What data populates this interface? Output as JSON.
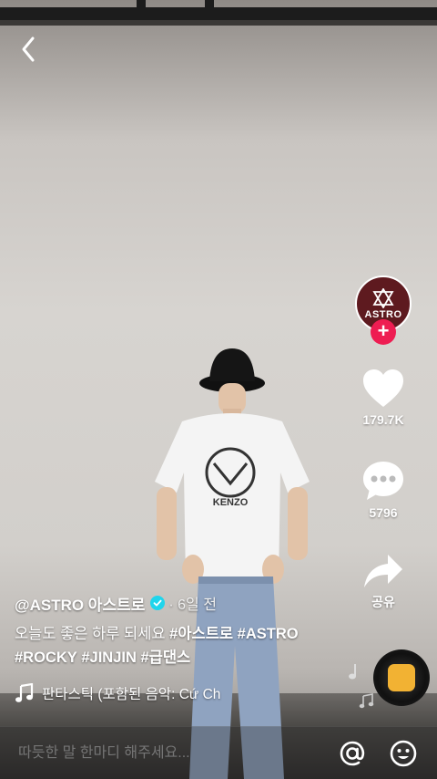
{
  "header": {
    "back_icon": "chevron-left-icon"
  },
  "creator": {
    "avatar_label": "ASTRO",
    "avatar_color": "#5e1a1f",
    "follow_icon": "plus-icon",
    "follow_color": "#ee1d52"
  },
  "actions": {
    "like_count": "179.7K",
    "comment_count": "5796",
    "share_label": "공유"
  },
  "post": {
    "username": "@ASTRO 아스트로",
    "verified_icon": "verified-badge-icon",
    "time_ago": "· 6일 전",
    "caption_text": "오늘도 좋은 하루 되세요",
    "hashtags": [
      "#아스트로",
      "#ASTRO",
      "#ROCKY",
      "#JINJIN",
      "#급댄스"
    ]
  },
  "music": {
    "icon": "music-note-icon",
    "title": "판타스틱 (포함된 음악: Cứ Ch"
  },
  "comment_bar": {
    "placeholder": "따듯한 말 한마디 해주세요...",
    "mention_icon": "at-icon",
    "emoji_icon": "emoji-icon"
  }
}
